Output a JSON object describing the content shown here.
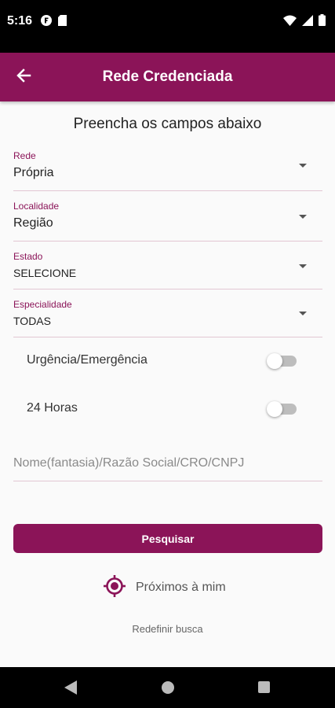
{
  "status_bar": {
    "time": "5:16",
    "left_icons": [
      "app-notification-icon",
      "sim-card-icon"
    ],
    "right_icons": [
      "wifi-icon",
      "cellular-signal-icon",
      "battery-icon"
    ]
  },
  "app_bar": {
    "title": "Rede Credenciada",
    "back_icon": "arrow-back-icon"
  },
  "form": {
    "subtitle": "Preencha os campos abaixo",
    "fields": [
      {
        "label": "Rede",
        "value": "Própria"
      },
      {
        "label": "Localidade",
        "value": "Região"
      },
      {
        "label": "Estado",
        "value": "SELECIONE"
      },
      {
        "label": "Especialidade",
        "value": "TODAS"
      }
    ],
    "toggles": [
      {
        "label": "Urgência/Emergência",
        "on": false
      },
      {
        "label": "24 Horas",
        "on": false
      }
    ],
    "search_placeholder": "Nome(fantasia)/Razão Social/CRO/CNPJ",
    "search_value": "",
    "search_button": "Pesquisar",
    "nearby_label": "Próximos à mim",
    "nearby_icon": "location-target-icon",
    "reset_label": "Redefinir busca"
  },
  "nav_bar": {
    "buttons": [
      "nav-back-icon",
      "nav-home-icon",
      "nav-recents-icon"
    ]
  },
  "colors": {
    "primary": "#8b1458",
    "status_bar": "#000000",
    "background": "#fafafa"
  }
}
